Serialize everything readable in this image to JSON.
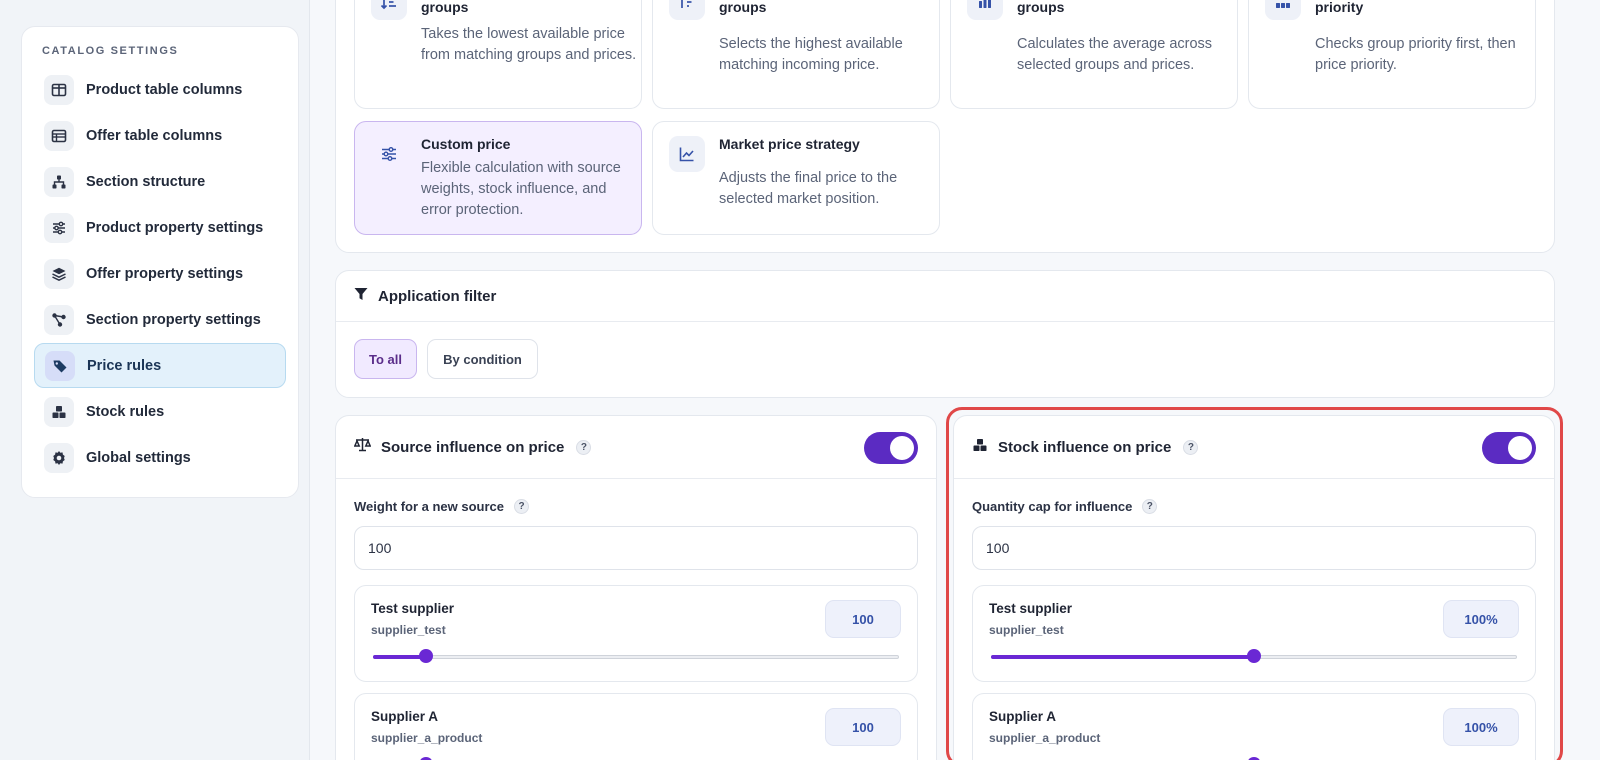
{
  "sidebar": {
    "heading": "CATALOG SETTINGS",
    "items": [
      {
        "label": "Product table columns",
        "icon": "columns-icon"
      },
      {
        "label": "Offer table columns",
        "icon": "table-icon"
      },
      {
        "label": "Section structure",
        "icon": "hierarchy-icon"
      },
      {
        "label": "Product property settings",
        "icon": "sliders-icon"
      },
      {
        "label": "Offer property settings",
        "icon": "layers-icon"
      },
      {
        "label": "Section property settings",
        "icon": "nodes-icon"
      },
      {
        "label": "Price rules",
        "icon": "tag-icon",
        "active": true
      },
      {
        "label": "Stock rules",
        "icon": "boxes-icon"
      },
      {
        "label": "Global settings",
        "icon": "gear-icon"
      }
    ]
  },
  "strategies": [
    {
      "title": "Minimum price from selected groups",
      "desc": "Takes the lowest available price from matching groups and prices.",
      "icon": "sort-ascending-icon"
    },
    {
      "title": "Maximum price from selected groups",
      "desc": "Selects the highest available matching incoming price.",
      "icon": "sort-descending-icon"
    },
    {
      "title": "Average price from selected groups",
      "desc": "Calculates the average across selected groups and prices.",
      "icon": "bar-chart-icon"
    },
    {
      "title": "First available price by group priority",
      "desc": "Checks group priority first, then price priority.",
      "icon": "priority-icon"
    },
    {
      "title": "Custom price",
      "desc": "Flexible calculation with source weights, stock influence, and error protection.",
      "icon": "sliders-icon",
      "selected": true
    },
    {
      "title": "Market price strategy",
      "desc": "Adjusts the final price to the selected market position.",
      "icon": "line-chart-icon"
    }
  ],
  "filter": {
    "title": "Application filter",
    "options": [
      "To all",
      "By condition"
    ],
    "selected": "To all"
  },
  "source_influence": {
    "title": "Source influence on price",
    "enabled": true,
    "field_label": "Weight for a new source",
    "field_value": "100",
    "suppliers": [
      {
        "name": "Test supplier",
        "code": "supplier_test",
        "value": "100",
        "level": 0.1
      },
      {
        "name": "Supplier A",
        "code": "supplier_a_product",
        "value": "100",
        "level": 0.1
      }
    ]
  },
  "stock_influence": {
    "title": "Stock influence on price",
    "enabled": true,
    "field_label": "Quantity cap for influence",
    "field_value": "100",
    "suppliers": [
      {
        "name": "Test supplier",
        "code": "supplier_test",
        "value": "100%",
        "level": 0.5
      },
      {
        "name": "Supplier A",
        "code": "supplier_a_product",
        "value": "100%",
        "level": 0.5
      }
    ]
  },
  "help_glyph": "?",
  "colors": {
    "accent": "#5b2bc2",
    "active_nav_bg": "#e3f1fb",
    "selected_card_bg": "#f4efff",
    "highlight_border": "#e04848"
  }
}
